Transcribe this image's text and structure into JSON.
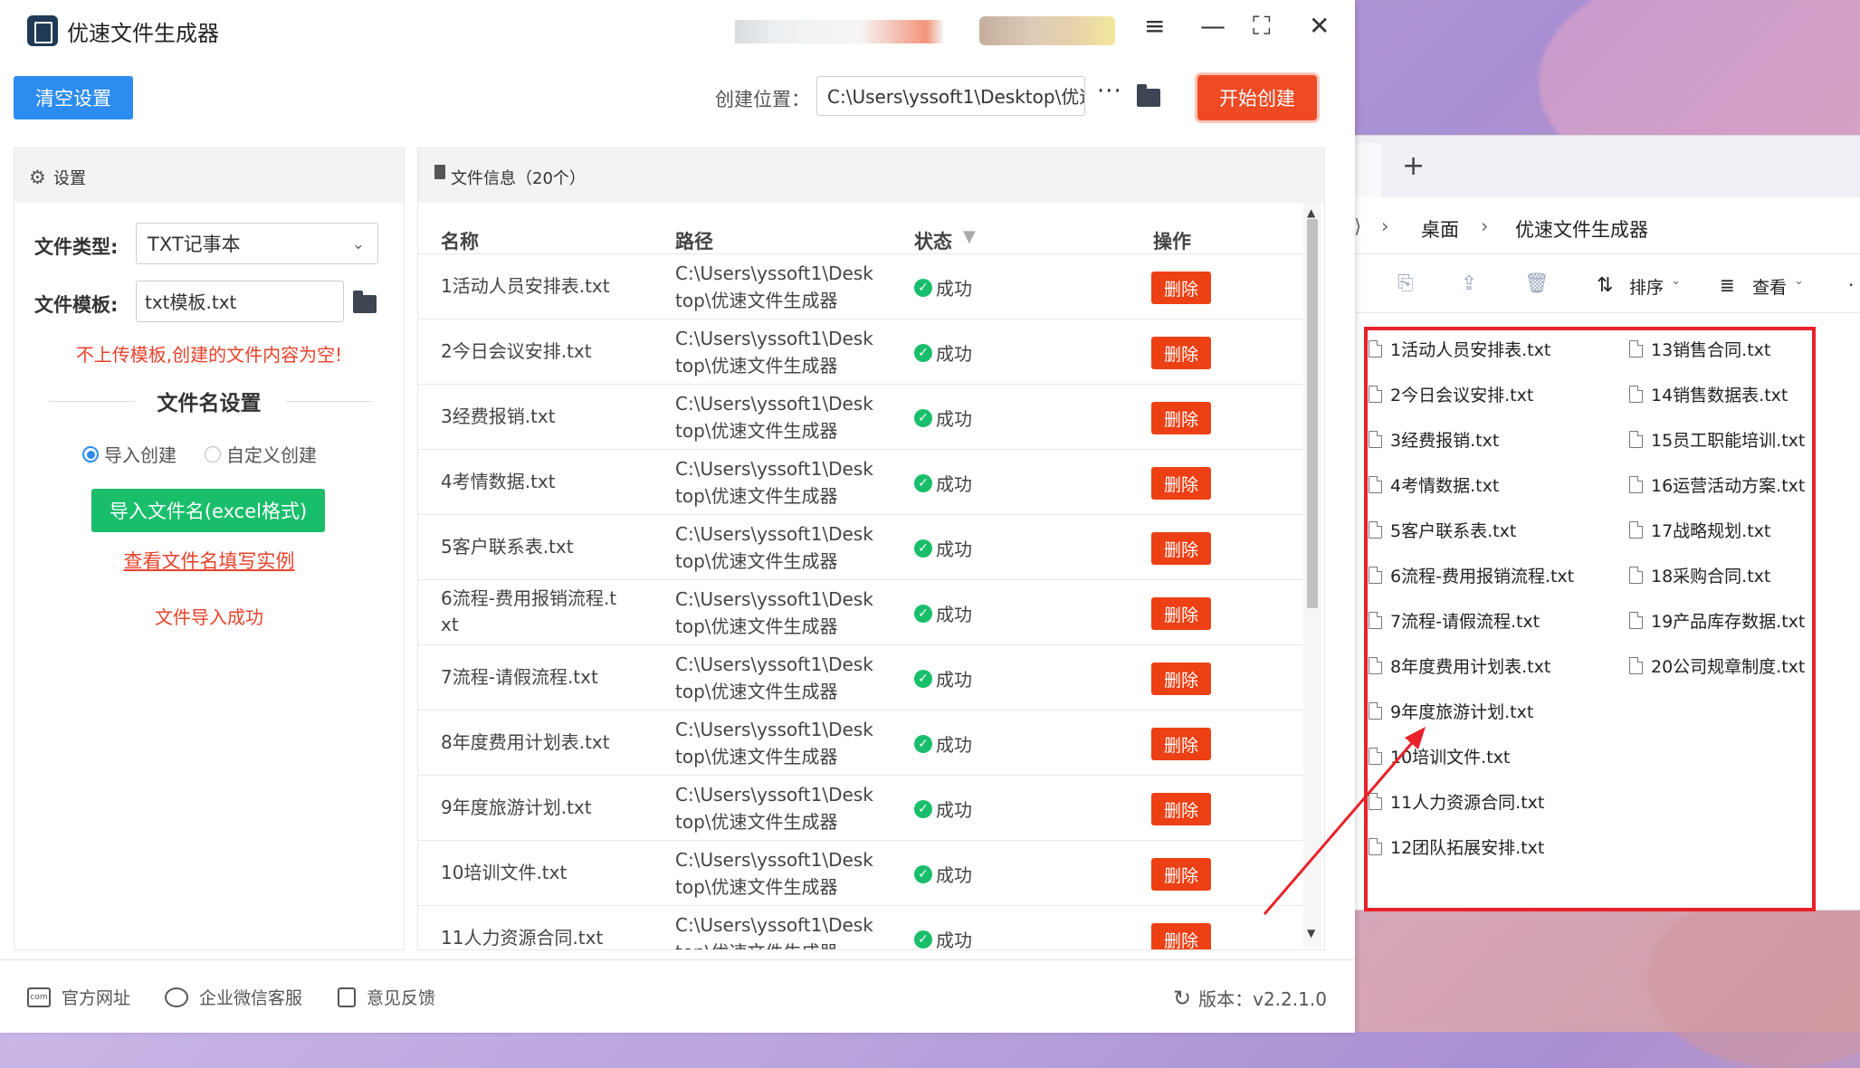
{
  "app": {
    "title": "优速文件生成器",
    "clear_button": "清空设置",
    "location_label": "创建位置：",
    "location_value": "C:\\Users\\yssoft1\\Desktop\\优速",
    "more_label": "···",
    "start_button": "开始创建"
  },
  "settings": {
    "header": "设置",
    "file_type_label": "文件类型:",
    "file_type_value": "TXT记事本",
    "template_label": "文件模板:",
    "template_value": "txt模板.txt",
    "warning": "不上传模板,创建的文件内容为空!",
    "section_title": "文件名设置",
    "radio_import": "导入创建",
    "radio_custom": "自定义创建",
    "import_button": "导入文件名(excel格式)",
    "example_link": "查看文件名填写实例",
    "import_status": "文件导入成功"
  },
  "file_panel": {
    "header": "文件信息（20个）",
    "columns": {
      "name": "名称",
      "path": "路径",
      "status": "状态",
      "action": "操作"
    },
    "delete_label": "删除",
    "rows": [
      {
        "name": "1活动人员安排表.txt",
        "path1": "C:\\Users\\yssoft1\\Desk",
        "path2": "top\\优速文件生成器",
        "status": "成功"
      },
      {
        "name": "2今日会议安排.txt",
        "path1": "C:\\Users\\yssoft1\\Desk",
        "path2": "top\\优速文件生成器",
        "status": "成功"
      },
      {
        "name": "3经费报销.txt",
        "path1": "C:\\Users\\yssoft1\\Desk",
        "path2": "top\\优速文件生成器",
        "status": "成功"
      },
      {
        "name": "4考情数据.txt",
        "path1": "C:\\Users\\yssoft1\\Desk",
        "path2": "top\\优速文件生成器",
        "status": "成功"
      },
      {
        "name": "5客户联系表.txt",
        "path1": "C:\\Users\\yssoft1\\Desk",
        "path2": "top\\优速文件生成器",
        "status": "成功"
      },
      {
        "name": "6流程-费用报销流程.t",
        "name2": "xt",
        "path1": "C:\\Users\\yssoft1\\Desk",
        "path2": "top\\优速文件生成器",
        "status": "成功"
      },
      {
        "name": "7流程-请假流程.txt",
        "path1": "C:\\Users\\yssoft1\\Desk",
        "path2": "top\\优速文件生成器",
        "status": "成功"
      },
      {
        "name": "8年度费用计划表.txt",
        "path1": "C:\\Users\\yssoft1\\Desk",
        "path2": "top\\优速文件生成器",
        "status": "成功"
      },
      {
        "name": "9年度旅游计划.txt",
        "path1": "C:\\Users\\yssoft1\\Desk",
        "path2": "top\\优速文件生成器",
        "status": "成功"
      },
      {
        "name": "10培训文件.txt",
        "path1": "C:\\Users\\yssoft1\\Desk",
        "path2": "top\\优速文件生成器",
        "status": "成功"
      },
      {
        "name": "11人力资源合同.txt",
        "path1": "C:\\Users\\yssoft1\\Desk",
        "path2": "top\\优速文件生成器",
        "status": "成功"
      }
    ]
  },
  "footer": {
    "website": "官方网址",
    "wechat": "企业微信客服",
    "feedback": "意见反馈",
    "version": "版本：v2.2.1.0"
  },
  "explorer": {
    "breadcrumb_desktop": "桌面",
    "breadcrumb_folder": "优速文件生成器",
    "sort_label": "排序",
    "view_label": "查看",
    "files_col1": [
      "1活动人员安排表.txt",
      "2今日会议安排.txt",
      "3经费报销.txt",
      "4考情数据.txt",
      "5客户联系表.txt",
      "6流程-费用报销流程.txt",
      "7流程-请假流程.txt",
      "8年度费用计划表.txt",
      "9年度旅游计划.txt",
      "10培训文件.txt",
      "11人力资源合同.txt",
      "12团队拓展安排.txt"
    ],
    "files_col2": [
      "13销售合同.txt",
      "14销售数据表.txt",
      "15员工职能培训.txt",
      "16运营活动方案.txt",
      "17战略规划.txt",
      "18采购合同.txt",
      "19产品库存数据.txt",
      "20公司规章制度.txt"
    ]
  },
  "colors": {
    "accent_blue": "#2d8cf0",
    "accent_red": "#ef4a24",
    "success_green": "#19be6b",
    "highlight_red": "#e8212a"
  }
}
